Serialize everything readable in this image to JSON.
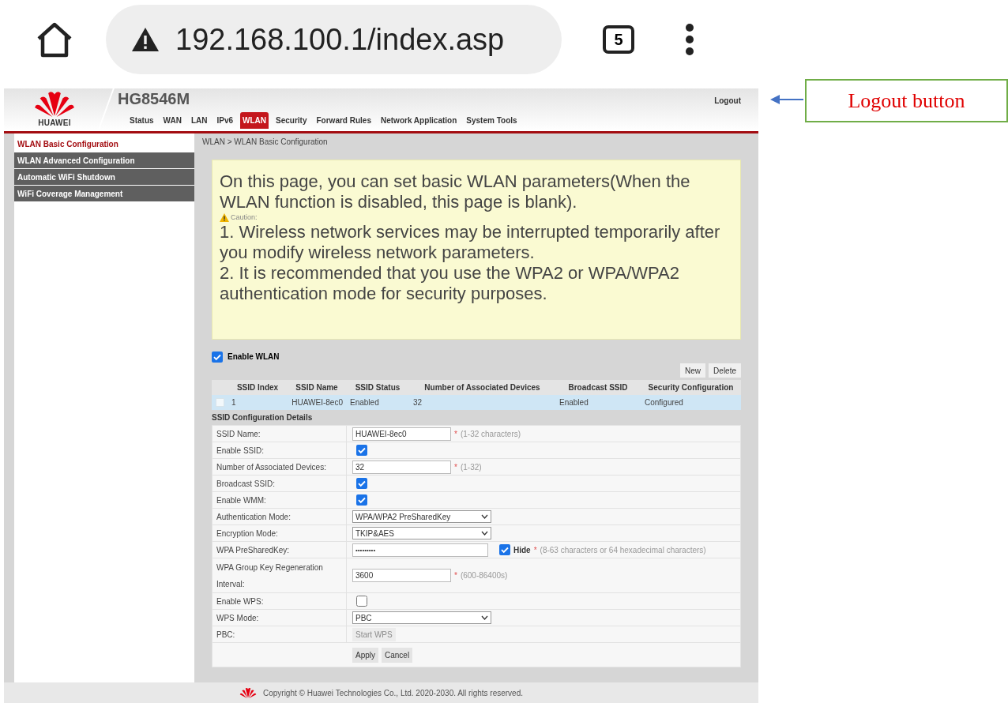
{
  "browser": {
    "url": "192.168.100.1/index.asp",
    "tab_count": "5"
  },
  "annotation": {
    "text": "Logout button"
  },
  "router": {
    "brand": "HUAWEI",
    "model": "HG8546M",
    "logout": "Logout",
    "nav": [
      {
        "label": "Status",
        "selected": false
      },
      {
        "label": "WAN",
        "selected": false
      },
      {
        "label": "LAN",
        "selected": false
      },
      {
        "label": "IPv6",
        "selected": false
      },
      {
        "label": "WLAN",
        "selected": true
      },
      {
        "label": "Security",
        "selected": false
      },
      {
        "label": "Forward Rules",
        "selected": false
      },
      {
        "label": "Network Application",
        "selected": false
      },
      {
        "label": "System Tools",
        "selected": false
      }
    ],
    "sidebar": [
      {
        "label": "WLAN Basic Configuration",
        "selected": true
      },
      {
        "label": "WLAN Advanced Configuration",
        "selected": false
      },
      {
        "label": "Automatic WiFi Shutdown",
        "selected": false
      },
      {
        "label": "WiFi Coverage Management",
        "selected": false
      }
    ],
    "breadcrumb": "WLAN > WLAN Basic Configuration",
    "notice": {
      "intro": "On this page, you can set basic WLAN parameters(When the WLAN function is disabled, this page is blank).",
      "caution": "Caution:",
      "items": [
        "1. Wireless network services may be interrupted temporarily after you modify wireless network parameters.",
        "2. It is recommended that you use the WPA2 or WPA/WPA2 authentication mode for security purposes."
      ]
    },
    "enable_wlan": {
      "label": "Enable WLAN",
      "checked": true
    },
    "table_buttons": [
      "New",
      "Delete"
    ],
    "table": {
      "columns": [
        "SSID Index",
        "SSID Name",
        "SSID Status",
        "Number of Associated Devices",
        "Broadcast SSID",
        "Security Configuration"
      ],
      "rows": [
        {
          "checked": false,
          "selected": true,
          "cells": [
            "1",
            "HUAWEI-8ec0",
            "Enabled",
            "32",
            "Enabled",
            "Configured"
          ]
        }
      ]
    },
    "section_title": "SSID Configuration Details",
    "fields": [
      {
        "kind": "text",
        "label": "SSID Name:",
        "value": "HUAWEI-8ec0",
        "required_mark": "*",
        "hint": "(1-32 characters)"
      },
      {
        "kind": "checkbox",
        "label": "Enable SSID:",
        "checked": true
      },
      {
        "kind": "text",
        "label": "Number of Associated Devices:",
        "value": "32",
        "required_mark": "*",
        "hint": "(1-32)"
      },
      {
        "kind": "checkbox",
        "label": "Broadcast SSID:",
        "checked": true
      },
      {
        "kind": "checkbox",
        "label": "Enable WMM:",
        "checked": true
      },
      {
        "kind": "select",
        "label": "Authentication Mode:",
        "value": "WPA/WPA2 PreSharedKey"
      },
      {
        "kind": "select",
        "label": "Encryption Mode:",
        "value": "TKIP&AES"
      },
      {
        "kind": "password",
        "label": "WPA PreSharedKey:",
        "value": "•••••••••",
        "hide_label": "Hide",
        "hide_checked": true,
        "required_mark": "*",
        "hint": "(8-63 characters or 64 hexadecimal characters)"
      },
      {
        "kind": "text",
        "label": "WPA Group Key Regeneration Interval:",
        "value": "3600",
        "required_mark": "*",
        "hint": "(600-86400s)"
      },
      {
        "kind": "checkbox",
        "label": "Enable WPS:",
        "checked": false
      },
      {
        "kind": "select",
        "label": "WPS Mode:",
        "value": "PBC"
      },
      {
        "kind": "button",
        "label": "PBC:",
        "button": "Start WPS",
        "disabled": true
      }
    ],
    "actions": [
      "Apply",
      "Cancel"
    ],
    "footer": "Copyright © Huawei Technologies Co., Ltd. 2020-2030. All rights reserved."
  }
}
